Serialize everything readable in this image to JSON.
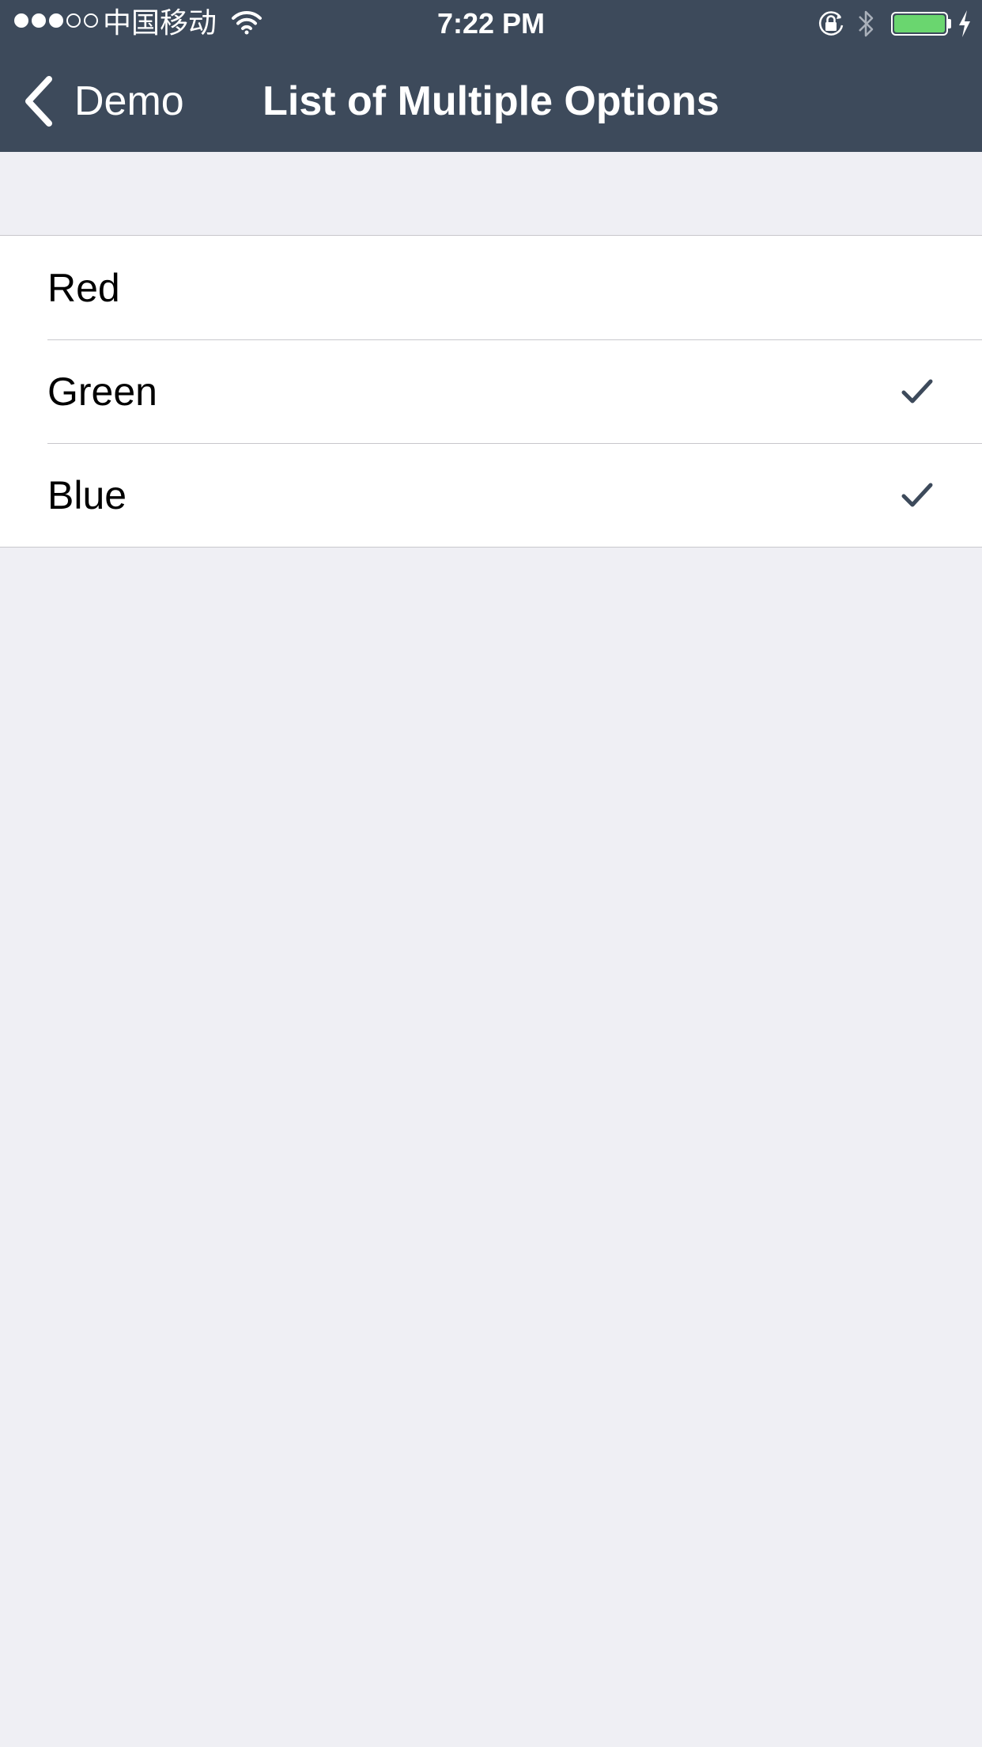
{
  "status_bar": {
    "signal": [
      true,
      true,
      true,
      false,
      false
    ],
    "carrier": "中国移动",
    "time": "7:22 PM",
    "icons": [
      "wifi-icon",
      "orientation-lock-icon",
      "bluetooth-icon",
      "battery-icon",
      "charging-bolt-icon"
    ],
    "battery_color": "#6ad66f"
  },
  "nav": {
    "back_label": "Demo",
    "title": "List of Multiple Options",
    "background": "#3d4a5b"
  },
  "list": {
    "items": [
      {
        "label": "Red",
        "checked": false
      },
      {
        "label": "Green",
        "checked": true
      },
      {
        "label": "Blue",
        "checked": true
      }
    ],
    "check_color": "#3d4a5b"
  }
}
